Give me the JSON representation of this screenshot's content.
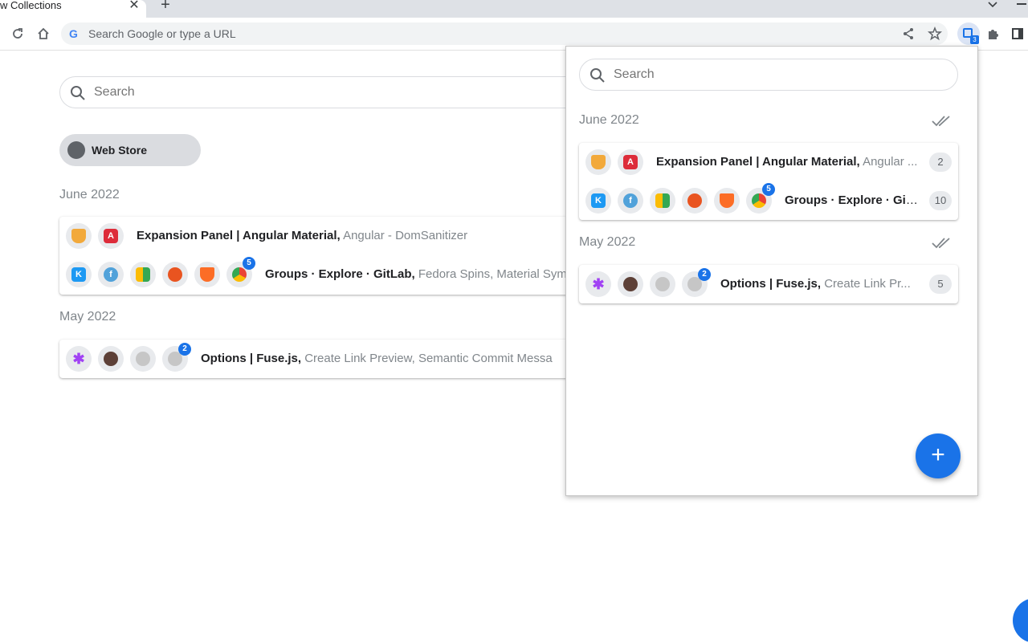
{
  "browser": {
    "tab_title": "w Collections",
    "tab_close": "✕",
    "new_tab": "+",
    "omnibox_placeholder": "Search Google or type a URL",
    "extension_badge": "3"
  },
  "page": {
    "search_placeholder": "Search",
    "chip_label": "Web Store",
    "sections": [
      {
        "heading": "June 2022",
        "rows": [
          {
            "bold": "Expansion Panel | Angular Material,",
            "rest": "Angular - DomSanitizer"
          },
          {
            "bold": "Groups · Explore · GitLab,",
            "rest": "Fedora Spins,   Material Sym",
            "badge": "5"
          }
        ]
      },
      {
        "heading": "May 2022",
        "rows": [
          {
            "bold": "Options | Fuse.js,",
            "rest": "Create Link Preview,   Semantic Commit Messa",
            "badge": "2"
          }
        ]
      }
    ]
  },
  "popup": {
    "search_placeholder": "Search",
    "sections": [
      {
        "heading": "June 2022",
        "rows": [
          {
            "bold": "Expansion Panel | Angular Material,",
            "rest": "Angular ...",
            "count": "2"
          },
          {
            "bold": "Groups · Explore · Git...",
            "rest": "",
            "count": "10",
            "badge": "5"
          }
        ]
      },
      {
        "heading": "May 2022",
        "rows": [
          {
            "bold": "Options | Fuse.js,",
            "rest": "Create Link Pr...",
            "count": "5",
            "badge": "2"
          }
        ]
      }
    ],
    "fab_label": "+"
  },
  "colors": {
    "accent": "#1a73e8",
    "muted_text": "#80868b"
  }
}
